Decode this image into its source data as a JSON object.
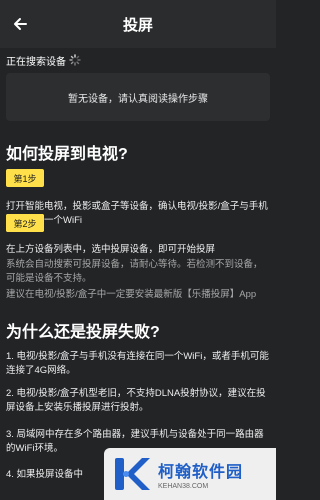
{
  "header": {
    "title": "投屏",
    "back_icon": "back-arrow-icon"
  },
  "search": {
    "status": "正在搜索设备",
    "icon": "spinner-icon"
  },
  "empty_notice": "暂无设备，请认真阅读操作步骤",
  "how_to": {
    "heading": "如何投屏到电视?",
    "step1": {
      "badge": "第1步",
      "text": "打开智能电视，投影或盒子等设备，确认电视/投影/盒子与手机连接着同一个WiFi"
    },
    "step2": {
      "badge": "第2步",
      "text": "在上方设备列表中，选中投屏设备，即可开始投屏",
      "note1": "系统会自动搜索可投屏设备，请耐心等待。若检测不到设备，可能是设备不支持。",
      "note2": "建议在电视/投影/盒子中一定要安装最新版【乐播投屏】App"
    }
  },
  "why_fail": {
    "heading": "为什么还是投屏失败?",
    "reasons": [
      "1. 电视/投影/盒子与手机没有连接在同一个WiFi，或者手机可能连接了4G网络。",
      "2. 电视/投影/盒子机型老旧，不支持DLNA投射协议，建议在投屏设备上安装乐播投屏进行投射。",
      "3. 局域网中存在多个路由器，建议手机与设备处于同一路由器的WiFi环境。",
      "4. 如果投屏设备中"
    ]
  },
  "watermark": {
    "name": "柯翰软件园",
    "url": "KEHAN38.COM"
  },
  "colors": {
    "accent": "#ffe04a",
    "background": "#222426",
    "brand_blue": "#1f5fc7"
  }
}
